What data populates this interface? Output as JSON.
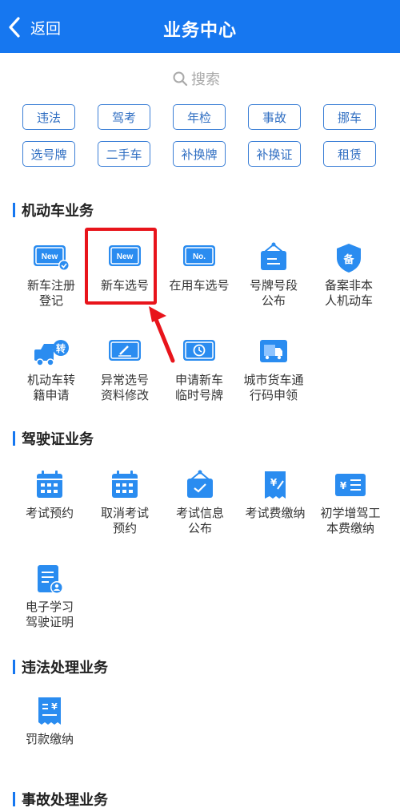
{
  "header": {
    "back_label": "返回",
    "title": "业务中心"
  },
  "search": {
    "placeholder": "搜索"
  },
  "tags": [
    "违法",
    "驾考",
    "年检",
    "事故",
    "挪车",
    "选号牌",
    "二手车",
    "补换牌",
    "补换证",
    "租赁"
  ],
  "sections": {
    "motor": {
      "title": "机动车业务",
      "items": [
        {
          "label": "新车注册\n登记",
          "icon": "new-plate-check-icon"
        },
        {
          "label": "新车选号",
          "icon": "new-plate-icon"
        },
        {
          "label": "在用车选号",
          "icon": "no-plate-icon"
        },
        {
          "label": "号牌号段\n公布",
          "icon": "announcement-board-icon"
        },
        {
          "label": "备案非本\n人机动车",
          "icon": "shield-bei-icon"
        },
        {
          "label": "机动车转\n籍申请",
          "icon": "truck-transfer-icon"
        },
        {
          "label": "异常选号\n资料修改",
          "icon": "plate-edit-icon"
        },
        {
          "label": "申请新车\n临时号牌",
          "icon": "plate-clock-icon"
        },
        {
          "label": "城市货车通\n行码申领",
          "icon": "cargo-truck-icon"
        }
      ]
    },
    "license": {
      "title": "驾驶证业务",
      "items": [
        {
          "label": "考试预约",
          "icon": "calendar-icon"
        },
        {
          "label": "取消考试\n预约",
          "icon": "calendar-cancel-icon"
        },
        {
          "label": "考试信息\n公布",
          "icon": "info-board-icon"
        },
        {
          "label": "考试费缴纳",
          "icon": "fee-receipt-icon"
        },
        {
          "label": "初学增驾工\n本费缴纳",
          "icon": "yen-card-icon"
        },
        {
          "label": "电子学习\n驾驶证明",
          "icon": "document-user-icon"
        }
      ]
    },
    "violation": {
      "title": "违法处理业务",
      "items": [
        {
          "label": "罚款缴纳",
          "icon": "fine-receipt-icon"
        }
      ]
    },
    "accident": {
      "title": "事故处理业务"
    }
  },
  "colors": {
    "primary": "#1677f0",
    "highlight": "#e8141b",
    "tag_border": "#3b7fd6"
  }
}
